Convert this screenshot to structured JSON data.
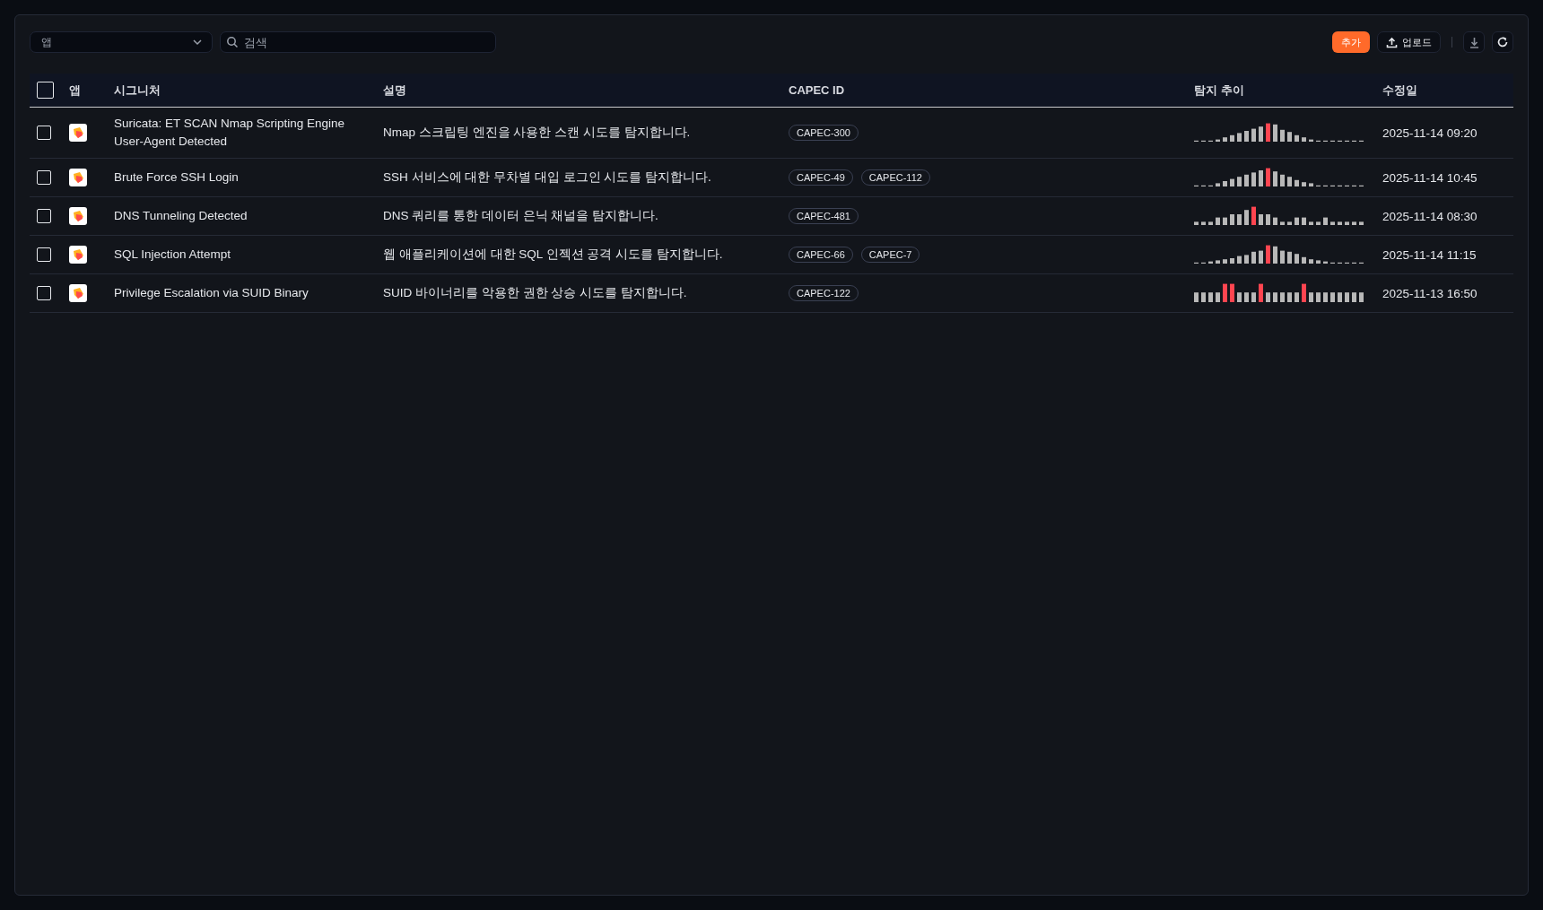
{
  "toolbar": {
    "app_filter": {
      "placeholder": "앱"
    },
    "search": {
      "placeholder": "검색"
    },
    "add_button": "추가",
    "upload_button": "업로드"
  },
  "table": {
    "select_all": {
      "checked": false
    },
    "columns": [
      "앱",
      "시그니처",
      "설명",
      "CAPEC ID",
      "탐지 추이",
      "수정일"
    ],
    "rows": [
      {
        "checked": false,
        "signature": "Suricata: ET SCAN Nmap Scripting Engine User-Agent Detected",
        "description": "Nmap 스크립팅 엔진을 사용한 스캔 시도를 탐지합니다.",
        "capec": [
          "CAPEC-300"
        ],
        "modified": "2025-11-14 09:20"
      },
      {
        "checked": false,
        "signature": "Brute Force SSH Login",
        "description": "SSH 서비스에 대한 무차별 대입 로그인 시도를 탐지합니다.",
        "capec": [
          "CAPEC-49",
          "CAPEC-112"
        ],
        "modified": "2025-11-14 10:45"
      },
      {
        "checked": false,
        "signature": "DNS Tunneling Detected",
        "description": "DNS 쿼리를 통한 데이터 은닉 채널을 탐지합니다.",
        "capec": [
          "CAPEC-481"
        ],
        "modified": "2025-11-14 08:30"
      },
      {
        "checked": false,
        "signature": "SQL Injection Attempt",
        "description": "웹 애플리케이션에 대한 SQL 인젝션 공격 시도를 탐지합니다.",
        "capec": [
          "CAPEC-66",
          "CAPEC-7"
        ],
        "modified": "2025-11-14 11:15"
      },
      {
        "checked": false,
        "signature": "Privilege Escalation via SUID Binary",
        "description": "SUID 바이너리를 악용한 권한 상승 시도를 탐지합니다.",
        "capec": [
          "CAPEC-122"
        ],
        "modified": "2025-11-13 16:50"
      }
    ]
  }
}
